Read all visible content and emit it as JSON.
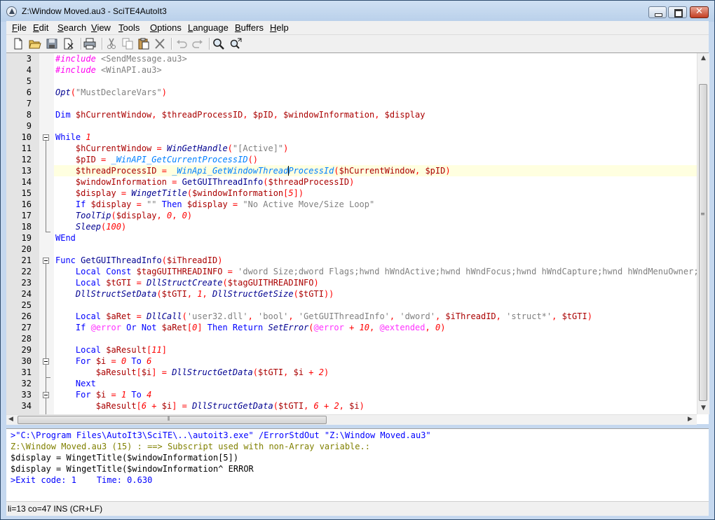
{
  "window": {
    "title": "Z:\\Window Moved.au3 - SciTE4AutoIt3"
  },
  "menu": [
    {
      "label": "File",
      "key": "F",
      "rest": "ile"
    },
    {
      "label": "Edit",
      "key": "E",
      "rest": "dit"
    },
    {
      "label": "Search",
      "key": "S",
      "rest": "earch"
    },
    {
      "label": "View",
      "key": "V",
      "rest": "iew"
    },
    {
      "label": "Tools",
      "key": "T",
      "rest": "ools"
    },
    {
      "label": "Options",
      "key": "O",
      "rest": "ptions"
    },
    {
      "label": "Language",
      "key": "L",
      "rest": "anguage"
    },
    {
      "label": "Buffers",
      "key": "B",
      "rest": "uffers"
    },
    {
      "label": "Help",
      "key": "H",
      "rest": "elp"
    }
  ],
  "toolbar_icons": [
    "new-file-icon",
    "open-folder-icon",
    "save-icon",
    "close-file-icon",
    "print-icon",
    "cut-icon",
    "copy-icon",
    "paste-icon",
    "delete-icon",
    "undo-icon",
    "redo-icon",
    "find-icon",
    "replace-icon"
  ],
  "editor": {
    "first_line": 3,
    "current_line": 13,
    "lines": [
      [
        [
          "inc",
          "#include "
        ],
        [
          "str",
          "<SendMessage.au3>"
        ]
      ],
      [
        [
          "inc",
          "#include "
        ],
        [
          "str",
          "<WinAPI.au3>"
        ]
      ],
      [],
      [
        [
          "func",
          "Opt"
        ],
        [
          "op",
          "("
        ],
        [
          "str",
          "\"MustDeclareVars\""
        ],
        [
          "op",
          ")"
        ]
      ],
      [],
      [
        [
          "kw",
          "Dim "
        ],
        [
          "var",
          "$hCurrentWindow"
        ],
        [
          "op",
          ", "
        ],
        [
          "var",
          "$threadProcessID"
        ],
        [
          "op",
          ", "
        ],
        [
          "var",
          "$pID"
        ],
        [
          "op",
          ", "
        ],
        [
          "var",
          "$windowInformation"
        ],
        [
          "op",
          ", "
        ],
        [
          "var",
          "$display"
        ]
      ],
      [],
      [
        [
          "kw",
          "While "
        ],
        [
          "num",
          "1"
        ]
      ],
      [
        [
          "plain",
          "    "
        ],
        [
          "var",
          "$hCurrentWindow"
        ],
        [
          "op",
          " = "
        ],
        [
          "func",
          "WinGetHandle"
        ],
        [
          "op",
          "("
        ],
        [
          "str",
          "\"[Active]\""
        ],
        [
          "op",
          ")"
        ]
      ],
      [
        [
          "plain",
          "    "
        ],
        [
          "var",
          "$pID"
        ],
        [
          "op",
          " = "
        ],
        [
          "udf",
          "_WinAPI_GetCurrentProcessID"
        ],
        [
          "op",
          "()"
        ]
      ],
      [
        [
          "plain",
          "    "
        ],
        [
          "var",
          "$threadProcessID"
        ],
        [
          "op",
          " = "
        ],
        [
          "udf",
          "_WinApi_GetWindowThreadProcessId"
        ],
        [
          "op",
          "("
        ],
        [
          "var",
          "$hCurrentWindow"
        ],
        [
          "op",
          ", "
        ],
        [
          "var",
          "$pID"
        ],
        [
          "op",
          ")"
        ]
      ],
      [
        [
          "plain",
          "    "
        ],
        [
          "var",
          "$windowInformation"
        ],
        [
          "op",
          " = "
        ],
        [
          "plain",
          "GetGUIThreadInfo"
        ],
        [
          "op",
          "("
        ],
        [
          "var",
          "$threadProcessID"
        ],
        [
          "op",
          ")"
        ]
      ],
      [
        [
          "plain",
          "    "
        ],
        [
          "var",
          "$display"
        ],
        [
          "op",
          " = "
        ],
        [
          "func",
          "WingetTitle"
        ],
        [
          "op",
          "("
        ],
        [
          "var",
          "$windowInformation"
        ],
        [
          "op",
          "["
        ],
        [
          "num",
          "5"
        ],
        [
          "op",
          "])"
        ]
      ],
      [
        [
          "plain",
          "    "
        ],
        [
          "kw",
          "If "
        ],
        [
          "var",
          "$display"
        ],
        [
          "op",
          " = "
        ],
        [
          "str",
          "\"\""
        ],
        [
          "kw",
          " Then "
        ],
        [
          "var",
          "$display"
        ],
        [
          "op",
          " = "
        ],
        [
          "str",
          "\"No Active Move/Size Loop\""
        ]
      ],
      [
        [
          "plain",
          "    "
        ],
        [
          "func",
          "ToolTip"
        ],
        [
          "op",
          "("
        ],
        [
          "var",
          "$display"
        ],
        [
          "op",
          ", "
        ],
        [
          "num",
          "0"
        ],
        [
          "op",
          ", "
        ],
        [
          "num",
          "0"
        ],
        [
          "op",
          ")"
        ]
      ],
      [
        [
          "plain",
          "    "
        ],
        [
          "func",
          "Sleep"
        ],
        [
          "op",
          "("
        ],
        [
          "num",
          "100"
        ],
        [
          "op",
          ")"
        ]
      ],
      [
        [
          "kw",
          "WEnd"
        ]
      ],
      [],
      [
        [
          "kw",
          "Func "
        ],
        [
          "plain",
          "GetGUIThreadInfo"
        ],
        [
          "op",
          "("
        ],
        [
          "var",
          "$iThreadID"
        ],
        [
          "op",
          ")"
        ]
      ],
      [
        [
          "plain",
          "    "
        ],
        [
          "kw",
          "Local Const "
        ],
        [
          "var",
          "$tagGUITHREADINFO"
        ],
        [
          "op",
          " = "
        ],
        [
          "str",
          "'dword Size;dword Flags;hwnd hWndActive;hwnd hWndFocus;hwnd hWndCapture;hwnd hWndMenuOwner;hwnd"
        ]
      ],
      [
        [
          "plain",
          "    "
        ],
        [
          "kw",
          "Local "
        ],
        [
          "var",
          "$tGTI"
        ],
        [
          "op",
          " = "
        ],
        [
          "func",
          "DllStructCreate"
        ],
        [
          "op",
          "("
        ],
        [
          "var",
          "$tagGUITHREADINFO"
        ],
        [
          "op",
          ")"
        ]
      ],
      [
        [
          "plain",
          "    "
        ],
        [
          "func",
          "DllStructSetData"
        ],
        [
          "op",
          "("
        ],
        [
          "var",
          "$tGTI"
        ],
        [
          "op",
          ", "
        ],
        [
          "num",
          "1"
        ],
        [
          "op",
          ", "
        ],
        [
          "func",
          "DllStructGetSize"
        ],
        [
          "op",
          "("
        ],
        [
          "var",
          "$tGTI"
        ],
        [
          "op",
          "))"
        ]
      ],
      [],
      [
        [
          "plain",
          "    "
        ],
        [
          "kw",
          "Local "
        ],
        [
          "var",
          "$aRet"
        ],
        [
          "op",
          " = "
        ],
        [
          "func",
          "DllCall"
        ],
        [
          "op",
          "("
        ],
        [
          "str",
          "'user32.dll'"
        ],
        [
          "op",
          ", "
        ],
        [
          "str",
          "'bool'"
        ],
        [
          "op",
          ", "
        ],
        [
          "str",
          "'GetGUIThreadInfo'"
        ],
        [
          "op",
          ", "
        ],
        [
          "str",
          "'dword'"
        ],
        [
          "op",
          ", "
        ],
        [
          "var",
          "$iThreadID"
        ],
        [
          "op",
          ", "
        ],
        [
          "str",
          "'struct*'"
        ],
        [
          "op",
          ", "
        ],
        [
          "var",
          "$tGTI"
        ],
        [
          "op",
          ")"
        ]
      ],
      [
        [
          "plain",
          "    "
        ],
        [
          "kw",
          "If "
        ],
        [
          "macro",
          "@error"
        ],
        [
          "kw",
          " Or Not "
        ],
        [
          "var",
          "$aRet"
        ],
        [
          "op",
          "["
        ],
        [
          "num",
          "0"
        ],
        [
          "op",
          "]"
        ],
        [
          "kw",
          " Then Return "
        ],
        [
          "func",
          "SetError"
        ],
        [
          "op",
          "("
        ],
        [
          "macro",
          "@error"
        ],
        [
          "op",
          " + "
        ],
        [
          "num",
          "10"
        ],
        [
          "op",
          ", "
        ],
        [
          "macro",
          "@extended"
        ],
        [
          "op",
          ", "
        ],
        [
          "num",
          "0"
        ],
        [
          "op",
          ")"
        ]
      ],
      [],
      [
        [
          "plain",
          "    "
        ],
        [
          "kw",
          "Local "
        ],
        [
          "var",
          "$aResult"
        ],
        [
          "op",
          "["
        ],
        [
          "num",
          "11"
        ],
        [
          "op",
          "]"
        ]
      ],
      [
        [
          "plain",
          "    "
        ],
        [
          "kw",
          "For "
        ],
        [
          "var",
          "$i"
        ],
        [
          "op",
          " = "
        ],
        [
          "num",
          "0"
        ],
        [
          "kw",
          " To "
        ],
        [
          "num",
          "6"
        ]
      ],
      [
        [
          "plain",
          "        "
        ],
        [
          "var",
          "$aResult"
        ],
        [
          "op",
          "["
        ],
        [
          "var",
          "$i"
        ],
        [
          "op",
          "] = "
        ],
        [
          "func",
          "DllStructGetData"
        ],
        [
          "op",
          "("
        ],
        [
          "var",
          "$tGTI"
        ],
        [
          "op",
          ", "
        ],
        [
          "var",
          "$i"
        ],
        [
          "op",
          " + "
        ],
        [
          "num",
          "2"
        ],
        [
          "op",
          ")"
        ]
      ],
      [
        [
          "plain",
          "    "
        ],
        [
          "kw",
          "Next"
        ]
      ],
      [
        [
          "plain",
          "    "
        ],
        [
          "kw",
          "For "
        ],
        [
          "var",
          "$i"
        ],
        [
          "op",
          " = "
        ],
        [
          "num",
          "1"
        ],
        [
          "kw",
          " To "
        ],
        [
          "num",
          "4"
        ]
      ],
      [
        [
          "plain",
          "        "
        ],
        [
          "var",
          "$aResult"
        ],
        [
          "op",
          "["
        ],
        [
          "num",
          "6"
        ],
        [
          "op",
          " + "
        ],
        [
          "var",
          "$i"
        ],
        [
          "op",
          "] = "
        ],
        [
          "func",
          "DllStructGetData"
        ],
        [
          "op",
          "("
        ],
        [
          "var",
          "$tGTI"
        ],
        [
          "op",
          ", "
        ],
        [
          "num",
          "6"
        ],
        [
          "op",
          " + "
        ],
        [
          "num",
          "2"
        ],
        [
          "op",
          ", "
        ],
        [
          "var",
          "$i"
        ],
        [
          "op",
          ")"
        ]
      ]
    ]
  },
  "output": [
    {
      "color": "#0000ff",
      "text": ">\"C:\\Program Files\\AutoIt3\\SciTE\\..\\autoit3.exe\" /ErrorStdOut \"Z:\\Window Moved.au3\""
    },
    {
      "color": "#808000",
      "text": "Z:\\Window Moved.au3 (15) : ==> Subscript used with non-Array variable.:"
    },
    {
      "color": "#000000",
      "text": "$display = WingetTitle($windowInformation[5])"
    },
    {
      "color": "#000000",
      "text": "$display = WingetTitle($windowInformation^ ERROR"
    },
    {
      "color": "#0000ff",
      "text": ">Exit code: 1    Time: 0.630"
    }
  ],
  "status": "li=13 co=47 INS (CR+LF)"
}
